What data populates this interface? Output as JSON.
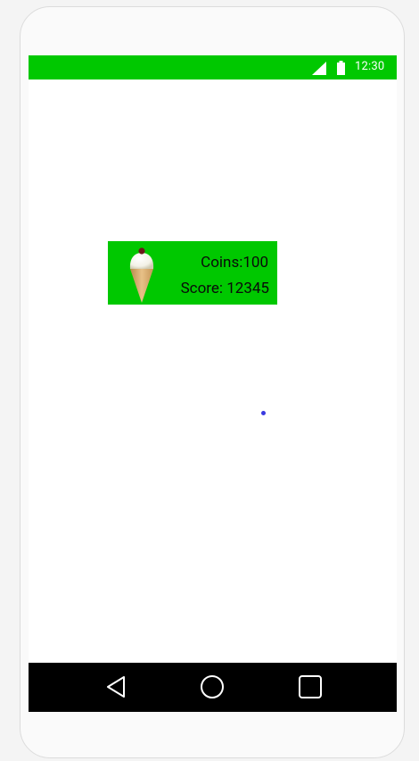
{
  "status_bar": {
    "time": "12:30",
    "color": "#00c800",
    "icons": [
      "signal-icon",
      "battery-icon"
    ]
  },
  "score_panel": {
    "coins_label": "Coins:100",
    "score_label": "Score: 12345",
    "icon": "ice-cream-cone-icon",
    "color": "#00c800"
  },
  "nav_bar": {
    "buttons": [
      "back-icon",
      "home-icon",
      "recents-icon"
    ],
    "color": "#000000"
  },
  "touch_indicator_color": "#3a3ae0"
}
